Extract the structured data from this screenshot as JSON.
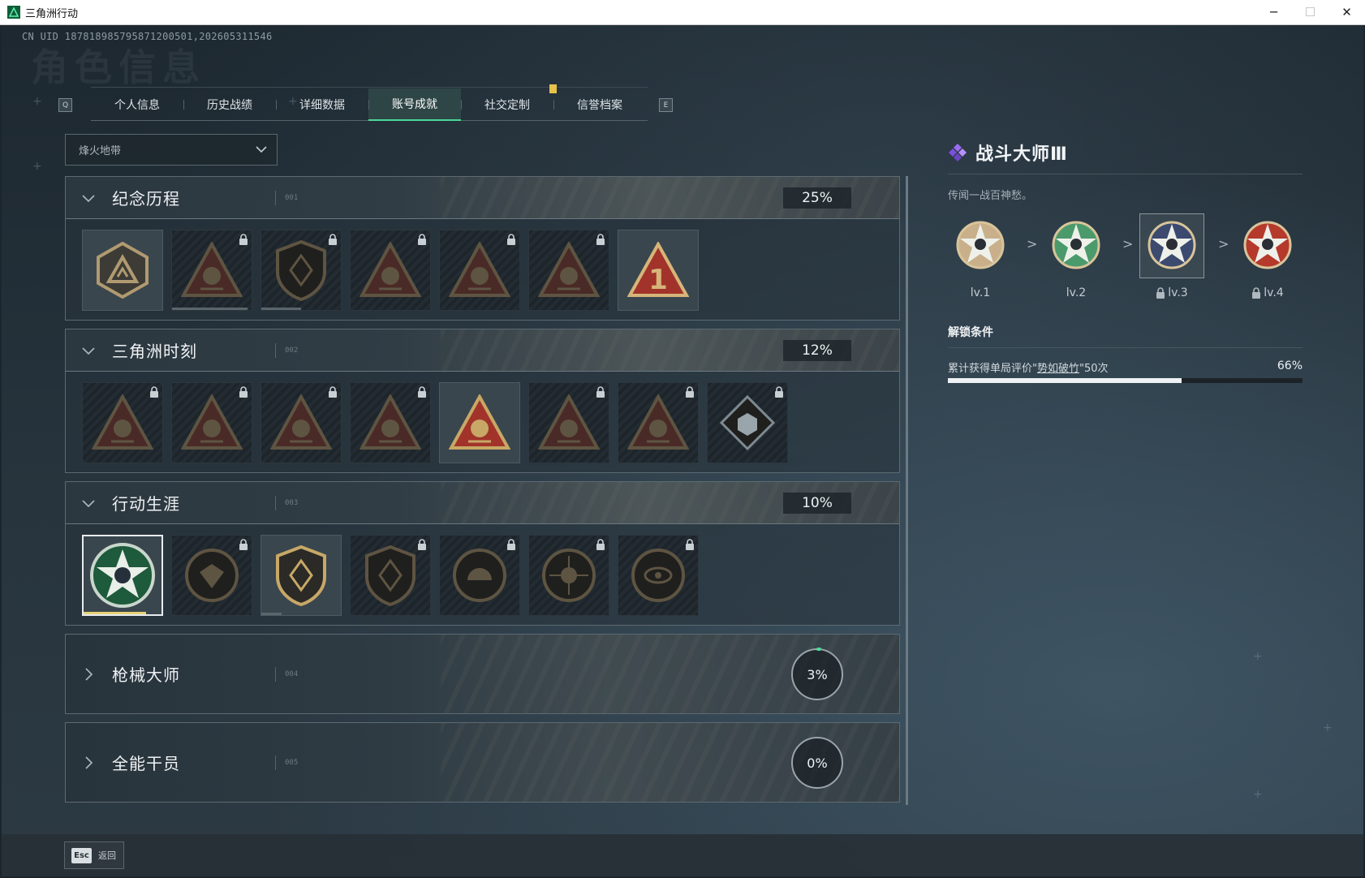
{
  "window": {
    "title": "三角洲行动",
    "controls": {
      "minimize": "─",
      "maximize": "☐",
      "close": "✕"
    }
  },
  "header": {
    "uid": "CN UID 18781898579587120050­1,202605311546",
    "watermark": "角色信息"
  },
  "tabs": {
    "prev_key": "Q",
    "next_key": "E",
    "items": [
      {
        "label": "个人信息",
        "active": false,
        "notify": false
      },
      {
        "label": "历史战绩",
        "active": false,
        "notify": false
      },
      {
        "label": "详细数据",
        "active": false,
        "notify": false
      },
      {
        "label": "账号成就",
        "active": true,
        "notify": false
      },
      {
        "label": "社交定制",
        "active": false,
        "notify": true
      },
      {
        "label": "信誉档案",
        "active": false,
        "notify": false
      }
    ]
  },
  "filter": {
    "selected": "烽火地带"
  },
  "categories": [
    {
      "name": "纪念历程",
      "code": "001",
      "percent": "25%",
      "expanded": true,
      "badges": [
        {
          "icon": "mountain-triangle-icon",
          "locked": false,
          "unlocked": true,
          "progress": 0
        },
        {
          "icon": "helicopter-icon",
          "locked": true,
          "unlocked": false,
          "progress": 0.95
        },
        {
          "icon": "shield-emblem-icon",
          "locked": true,
          "unlocked": false,
          "progress": 0.5
        },
        {
          "icon": "crossed-rifles-icon",
          "locked": true,
          "unlocked": false,
          "progress": 0
        },
        {
          "icon": "hooded-operator-icon",
          "locked": true,
          "unlocked": false,
          "progress": 0
        },
        {
          "icon": "helmet-soldier-icon",
          "locked": true,
          "unlocked": false,
          "progress": 0
        },
        {
          "icon": "rank-one-triangle-icon",
          "locked": false,
          "unlocked": true,
          "progress": 0
        }
      ]
    },
    {
      "name": "三角洲时刻",
      "code": "002",
      "percent": "12%",
      "expanded": true,
      "badges": [
        {
          "icon": "backpack-triangle-icon",
          "locked": true,
          "unlocked": false,
          "progress": 0
        },
        {
          "icon": "armor-vest-icon",
          "locked": true,
          "unlocked": false,
          "progress": 0
        },
        {
          "icon": "sitting-figure-icon",
          "locked": true,
          "unlocked": false,
          "progress": 0
        },
        {
          "icon": "hands-gem-icon",
          "locked": true,
          "unlocked": false,
          "progress": 0
        },
        {
          "icon": "squad-triangle-icon",
          "locked": false,
          "unlocked": true,
          "progress": 0
        },
        {
          "icon": "warriors-triangle-icon",
          "locked": true,
          "unlocked": false,
          "progress": 0
        },
        {
          "icon": "fish-triangle-icon",
          "locked": true,
          "unlocked": false,
          "progress": 0
        },
        {
          "icon": "cube-diamond-icon",
          "locked": true,
          "unlocked": false,
          "progress": 0
        }
      ]
    },
    {
      "name": "行动生涯",
      "code": "003",
      "percent": "10%",
      "expanded": true,
      "badges": [
        {
          "icon": "green-star-skull-icon",
          "locked": false,
          "unlocked": true,
          "selected": true,
          "progress": 0.8
        },
        {
          "icon": "winged-shield-icon",
          "locked": true,
          "unlocked": false,
          "progress": 0
        },
        {
          "icon": "double-arrow-shield-icon",
          "locked": false,
          "unlocked": true,
          "progress": 0.25
        },
        {
          "icon": "hexagram-shield-icon",
          "locked": true,
          "unlocked": false,
          "progress": 0
        },
        {
          "icon": "round-helmet-icon",
          "locked": true,
          "unlocked": false,
          "progress": 0
        },
        {
          "icon": "skull-crosshair-icon",
          "locked": true,
          "unlocked": false,
          "progress": 0
        },
        {
          "icon": "eye-round-icon",
          "locked": true,
          "unlocked": false,
          "progress": 0
        }
      ]
    },
    {
      "name": "枪械大师",
      "code": "004",
      "percent": "3%",
      "expanded": false,
      "badges": []
    },
    {
      "name": "全能干员",
      "code": "005",
      "percent": "0%",
      "expanded": false,
      "badges": []
    }
  ],
  "detail": {
    "title": "战斗大师Ⅲ",
    "description": "传闻一战百神愁。",
    "levels": [
      {
        "label": "lv.1",
        "locked": false,
        "current": false,
        "color": "#c9b08a"
      },
      {
        "label": "lv.2",
        "locked": false,
        "current": false,
        "color": "#4b9a6c"
      },
      {
        "label": "lv.3",
        "locked": true,
        "current": true,
        "color": "#3b4a6e"
      },
      {
        "label": "lv.4",
        "locked": true,
        "current": false,
        "color": "#b53a2c"
      }
    ],
    "level_separator": ">",
    "unlock_title": "解锁条件",
    "condition": {
      "prefix": "累计获得单局评价\"",
      "highlight": "势如破竹",
      "suffix": "\"50次",
      "percent": "66%",
      "progress": 0.66
    }
  },
  "footer": {
    "esc_key": "Esc",
    "back_label": "返回"
  },
  "colors": {
    "accent_green": "#4bd896",
    "notify_yellow": "#e6c24a",
    "title_purple": "#9a6cf2"
  }
}
